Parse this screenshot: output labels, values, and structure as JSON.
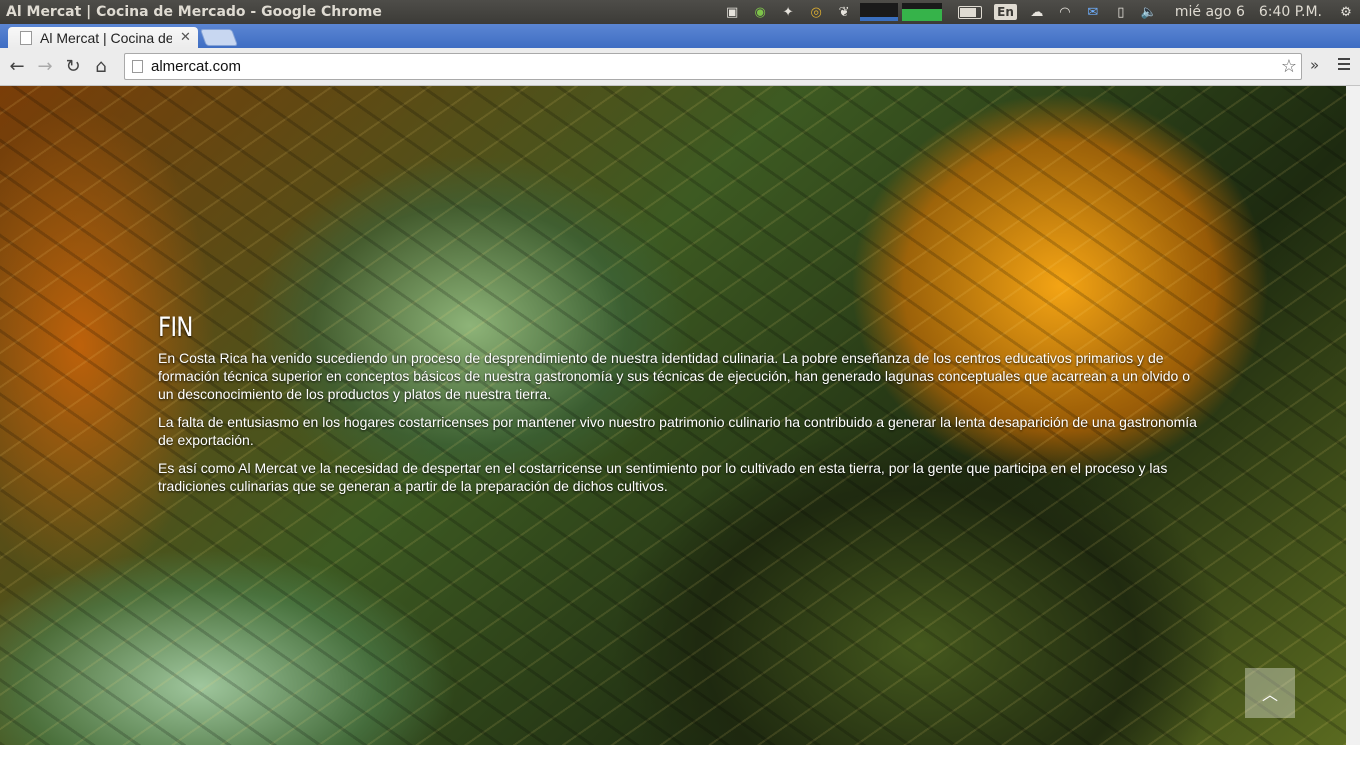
{
  "os_panel": {
    "window_title": "Al Mercat | Cocina de Mercado - Google Chrome",
    "language": "En",
    "date": "mié ago  6",
    "time": "6:40 P.M."
  },
  "browser": {
    "tab_title": "Al Mercat | Cocina de Mercado",
    "url": "almercat.com"
  },
  "page": {
    "heading": "FIN",
    "paragraphs": [
      "En Costa Rica ha venido sucediendo un proceso de desprendimiento de nuestra identidad culinaria. La pobre enseñanza de los centros educativos primarios y de formación técnica superior en conceptos básicos de nuestra gastronomía y sus técnicas de ejecución, han generado lagunas conceptuales que acarrean a un olvido o un desconocimiento de los productos y platos de nuestra tierra.",
      "La falta de entusiasmo en los hogares costarricenses por mantener vivo nuestro patrimonio culinario ha contribuido a generar la lenta desaparición de una gastronomía de exportación.",
      "Es así como Al Mercat ve la necesidad de despertar en el costarricense un sentimiento por lo cultivado en esta tierra, por la gente que participa en el proceso y las tradiciones culinarias que se generan a partir de la preparación de dichos cultivos."
    ],
    "scroll_top_icon": "chevron-up-icon"
  }
}
